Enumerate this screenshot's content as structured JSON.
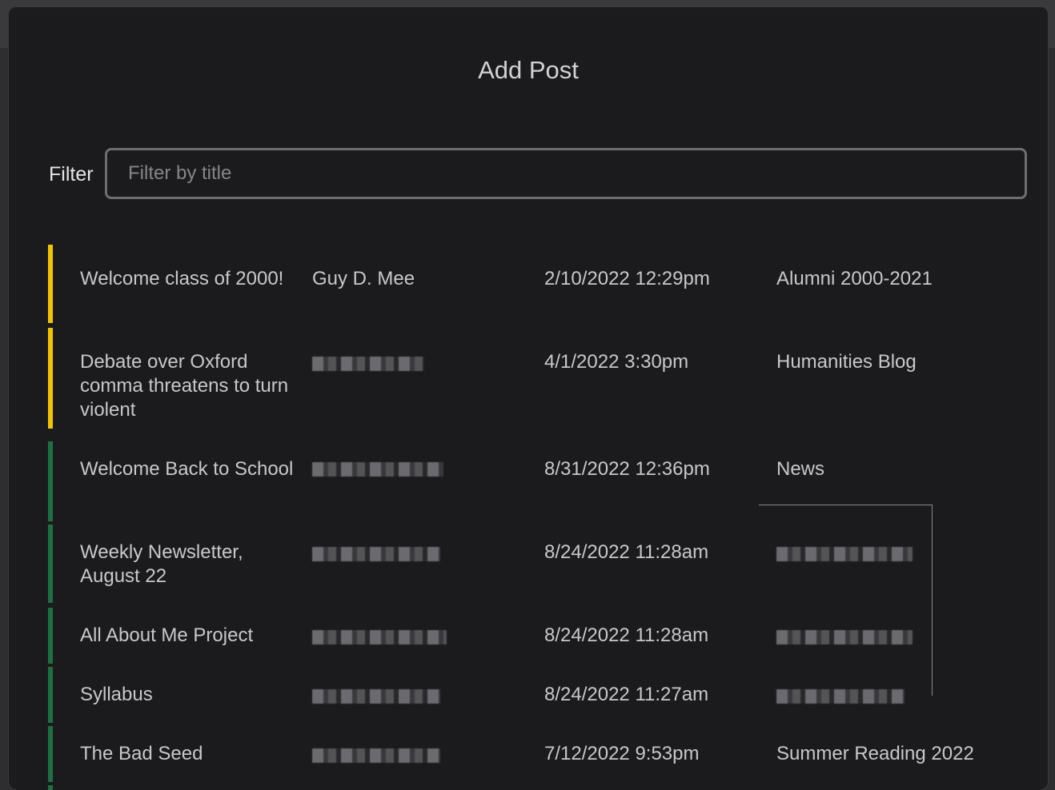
{
  "modal": {
    "title": "Add Post",
    "filter": {
      "label": "Filter",
      "placeholder": "Filter by title",
      "value": ""
    }
  },
  "colors": {
    "published": "#1f6f43",
    "draft": "#f2c400"
  },
  "posts": [
    {
      "title": "Welcome class of 2000!",
      "author": "Guy D. Mee",
      "date": "2/10/2022 12:29pm",
      "blog": "Alumni 2000-2021",
      "status": "draft",
      "author_redacted": false,
      "blog_redacted": false
    },
    {
      "title": "Debate over Oxford comma threatens to turn violent",
      "author": "",
      "date": "4/1/2022 3:30pm",
      "blog": "Humanities Blog",
      "status": "draft",
      "author_redacted": true,
      "blog_redacted": false
    },
    {
      "title": "Welcome Back to School",
      "author": "",
      "date": "8/31/2022 12:36pm",
      "blog": "News",
      "status": "published",
      "author_redacted": true,
      "blog_redacted": false
    },
    {
      "title": "Weekly Newsletter, August 22",
      "author": "",
      "date": "8/24/2022 11:28am",
      "blog": "",
      "status": "published",
      "author_redacted": true,
      "blog_redacted": true
    },
    {
      "title": "All About Me Project",
      "author": "",
      "date": "8/24/2022 11:28am",
      "blog": "",
      "status": "published",
      "author_redacted": true,
      "blog_redacted": true
    },
    {
      "title": "Syllabus",
      "author": "",
      "date": "8/24/2022 11:27am",
      "blog": "",
      "status": "published",
      "author_redacted": true,
      "blog_redacted": true
    },
    {
      "title": "The Bad Seed",
      "author": "",
      "date": "7/12/2022 9:53pm",
      "blog": "Summer Reading 2022",
      "status": "published",
      "author_redacted": true,
      "blog_redacted": false
    }
  ]
}
